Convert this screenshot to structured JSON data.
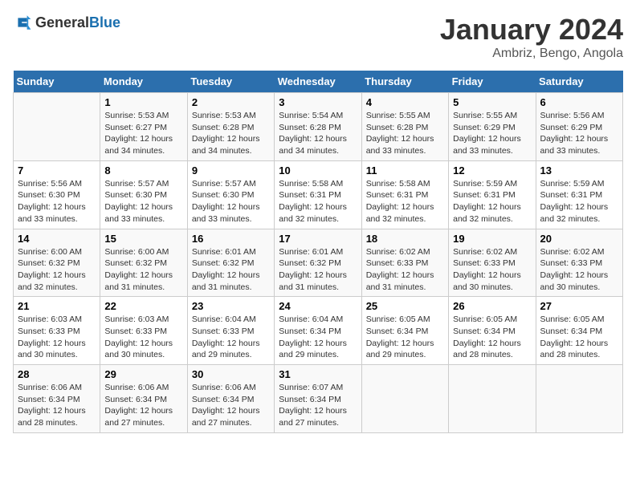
{
  "header": {
    "logo_general": "General",
    "logo_blue": "Blue",
    "month_title": "January 2024",
    "location": "Ambriz, Bengo, Angola"
  },
  "days_of_week": [
    "Sunday",
    "Monday",
    "Tuesday",
    "Wednesday",
    "Thursday",
    "Friday",
    "Saturday"
  ],
  "weeks": [
    [
      {
        "day": "",
        "content": ""
      },
      {
        "day": "1",
        "content": "Sunrise: 5:53 AM\nSunset: 6:27 PM\nDaylight: 12 hours\nand 34 minutes."
      },
      {
        "day": "2",
        "content": "Sunrise: 5:53 AM\nSunset: 6:28 PM\nDaylight: 12 hours\nand 34 minutes."
      },
      {
        "day": "3",
        "content": "Sunrise: 5:54 AM\nSunset: 6:28 PM\nDaylight: 12 hours\nand 34 minutes."
      },
      {
        "day": "4",
        "content": "Sunrise: 5:55 AM\nSunset: 6:28 PM\nDaylight: 12 hours\nand 33 minutes."
      },
      {
        "day": "5",
        "content": "Sunrise: 5:55 AM\nSunset: 6:29 PM\nDaylight: 12 hours\nand 33 minutes."
      },
      {
        "day": "6",
        "content": "Sunrise: 5:56 AM\nSunset: 6:29 PM\nDaylight: 12 hours\nand 33 minutes."
      }
    ],
    [
      {
        "day": "7",
        "content": "Sunrise: 5:56 AM\nSunset: 6:30 PM\nDaylight: 12 hours\nand 33 minutes."
      },
      {
        "day": "8",
        "content": "Sunrise: 5:57 AM\nSunset: 6:30 PM\nDaylight: 12 hours\nand 33 minutes."
      },
      {
        "day": "9",
        "content": "Sunrise: 5:57 AM\nSunset: 6:30 PM\nDaylight: 12 hours\nand 33 minutes."
      },
      {
        "day": "10",
        "content": "Sunrise: 5:58 AM\nSunset: 6:31 PM\nDaylight: 12 hours\nand 32 minutes."
      },
      {
        "day": "11",
        "content": "Sunrise: 5:58 AM\nSunset: 6:31 PM\nDaylight: 12 hours\nand 32 minutes."
      },
      {
        "day": "12",
        "content": "Sunrise: 5:59 AM\nSunset: 6:31 PM\nDaylight: 12 hours\nand 32 minutes."
      },
      {
        "day": "13",
        "content": "Sunrise: 5:59 AM\nSunset: 6:31 PM\nDaylight: 12 hours\nand 32 minutes."
      }
    ],
    [
      {
        "day": "14",
        "content": "Sunrise: 6:00 AM\nSunset: 6:32 PM\nDaylight: 12 hours\nand 32 minutes."
      },
      {
        "day": "15",
        "content": "Sunrise: 6:00 AM\nSunset: 6:32 PM\nDaylight: 12 hours\nand 31 minutes."
      },
      {
        "day": "16",
        "content": "Sunrise: 6:01 AM\nSunset: 6:32 PM\nDaylight: 12 hours\nand 31 minutes."
      },
      {
        "day": "17",
        "content": "Sunrise: 6:01 AM\nSunset: 6:32 PM\nDaylight: 12 hours\nand 31 minutes."
      },
      {
        "day": "18",
        "content": "Sunrise: 6:02 AM\nSunset: 6:33 PM\nDaylight: 12 hours\nand 31 minutes."
      },
      {
        "day": "19",
        "content": "Sunrise: 6:02 AM\nSunset: 6:33 PM\nDaylight: 12 hours\nand 30 minutes."
      },
      {
        "day": "20",
        "content": "Sunrise: 6:02 AM\nSunset: 6:33 PM\nDaylight: 12 hours\nand 30 minutes."
      }
    ],
    [
      {
        "day": "21",
        "content": "Sunrise: 6:03 AM\nSunset: 6:33 PM\nDaylight: 12 hours\nand 30 minutes."
      },
      {
        "day": "22",
        "content": "Sunrise: 6:03 AM\nSunset: 6:33 PM\nDaylight: 12 hours\nand 30 minutes."
      },
      {
        "day": "23",
        "content": "Sunrise: 6:04 AM\nSunset: 6:33 PM\nDaylight: 12 hours\nand 29 minutes."
      },
      {
        "day": "24",
        "content": "Sunrise: 6:04 AM\nSunset: 6:34 PM\nDaylight: 12 hours\nand 29 minutes."
      },
      {
        "day": "25",
        "content": "Sunrise: 6:05 AM\nSunset: 6:34 PM\nDaylight: 12 hours\nand 29 minutes."
      },
      {
        "day": "26",
        "content": "Sunrise: 6:05 AM\nSunset: 6:34 PM\nDaylight: 12 hours\nand 28 minutes."
      },
      {
        "day": "27",
        "content": "Sunrise: 6:05 AM\nSunset: 6:34 PM\nDaylight: 12 hours\nand 28 minutes."
      }
    ],
    [
      {
        "day": "28",
        "content": "Sunrise: 6:06 AM\nSunset: 6:34 PM\nDaylight: 12 hours\nand 28 minutes."
      },
      {
        "day": "29",
        "content": "Sunrise: 6:06 AM\nSunset: 6:34 PM\nDaylight: 12 hours\nand 27 minutes."
      },
      {
        "day": "30",
        "content": "Sunrise: 6:06 AM\nSunset: 6:34 PM\nDaylight: 12 hours\nand 27 minutes."
      },
      {
        "day": "31",
        "content": "Sunrise: 6:07 AM\nSunset: 6:34 PM\nDaylight: 12 hours\nand 27 minutes."
      },
      {
        "day": "",
        "content": ""
      },
      {
        "day": "",
        "content": ""
      },
      {
        "day": "",
        "content": ""
      }
    ]
  ]
}
